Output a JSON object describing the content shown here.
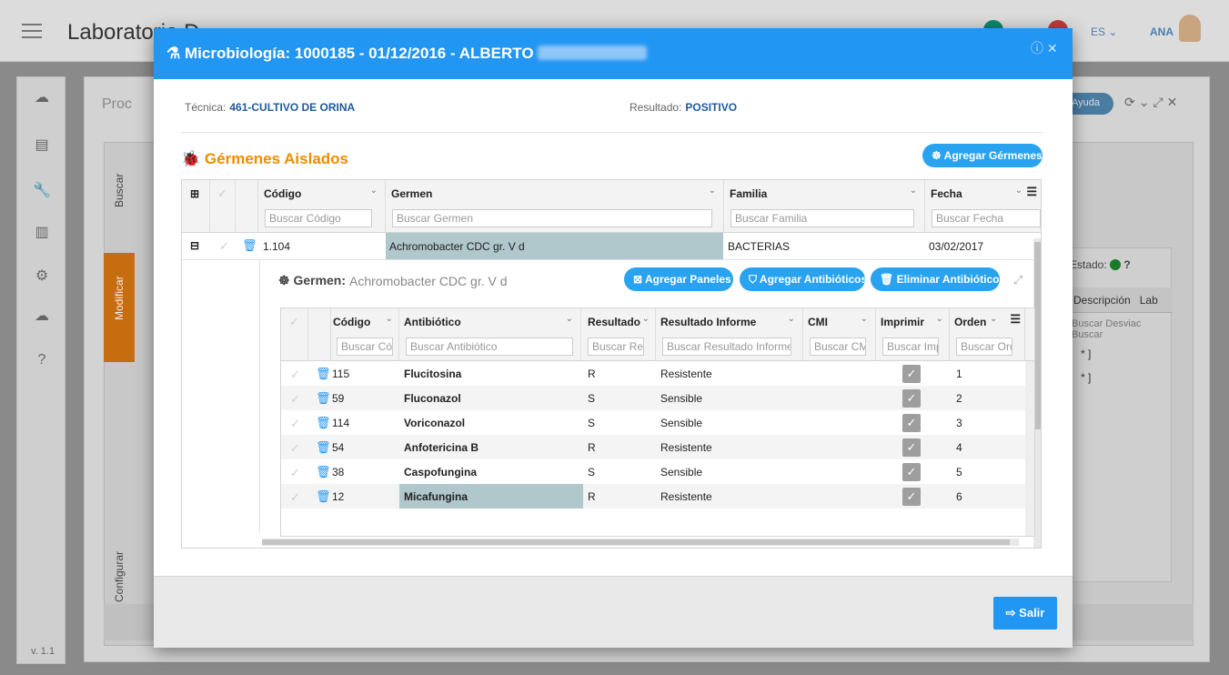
{
  "background": {
    "app_title": "Laboratorio D",
    "lang": "ES",
    "user": "ANA",
    "proc_title": "Proc",
    "ayuda_label": "Ayuda",
    "version": "v. 1.1",
    "tabs": {
      "buscar": "Buscar",
      "modificar": "Modificar",
      "configurar": "Configurar"
    },
    "estado_label": "Estado:",
    "right_headers": [
      "Descripción",
      "Lab"
    ],
    "right_search": [
      "Buscar Desviac",
      "Buscar"
    ],
    "right_rows": [
      "* ]",
      "* ]"
    ]
  },
  "modal": {
    "title": "Microbiología: 1000185 - 01/12/2016 - ALBERTO",
    "tecnica_label": "Técnica:",
    "tecnica_value": "461-CULTIVO DE ORINA",
    "resultado_label": "Resultado:",
    "resultado_value": "POSITIVO",
    "section_title": "Gérmenes Aislados",
    "add_germs_btn": "Agregar Gérmenes",
    "exit_btn": "Salir"
  },
  "germs_grid": {
    "headers": {
      "codigo": "Código",
      "germen": "Germen",
      "familia": "Familia",
      "fecha": "Fecha"
    },
    "placeholders": {
      "codigo": "Buscar Código",
      "germen": "Buscar Germen",
      "familia": "Buscar Familia",
      "fecha": "Buscar Fecha"
    },
    "row": {
      "codigo": "1.104",
      "germen": "Achromobacter CDC gr. V d",
      "familia": "BACTERIAS",
      "fecha": "03/02/2017"
    }
  },
  "detail": {
    "germen_label": "Germen:",
    "germen_value": "Achromobacter CDC gr. V d",
    "btn_paneles": "Agregar Paneles",
    "btn_antibioticos": "Agregar Antibióticos",
    "btn_eliminar": "Eliminar Antibióticos",
    "headers": {
      "codigo": "Código",
      "antibiotico": "Antibiótico",
      "resultado": "Resultado",
      "informe": "Resultado Informe",
      "cmi": "CMI",
      "imprimir": "Imprimir",
      "orden": "Orden"
    },
    "placeholders": {
      "codigo": "Buscar Cód",
      "antibiotico": "Buscar Antibiótico",
      "resultado": "Buscar Res",
      "informe": "Buscar Resultado Informe",
      "cmi": "Buscar CMI",
      "imprimir": "Buscar Imp",
      "orden": "Buscar Ord"
    },
    "rows": [
      {
        "codigo": "115",
        "antibiotico": "Flucitosina",
        "resultado": "R",
        "informe": "Resistente",
        "orden": "1"
      },
      {
        "codigo": "59",
        "antibiotico": "Fluconazol",
        "resultado": "S",
        "informe": "Sensible",
        "orden": "2"
      },
      {
        "codigo": "114",
        "antibiotico": "Voriconazol",
        "resultado": "S",
        "informe": "Sensible",
        "orden": "3"
      },
      {
        "codigo": "54",
        "antibiotico": "Anfotericina B",
        "resultado": "R",
        "informe": "Resistente",
        "orden": "4"
      },
      {
        "codigo": "38",
        "antibiotico": "Caspofungina",
        "resultado": "S",
        "informe": "Sensible",
        "orden": "5"
      },
      {
        "codigo": "12",
        "antibiotico": "Micafungina",
        "resultado": "R",
        "informe": "Resistente",
        "orden": "6"
      }
    ]
  }
}
